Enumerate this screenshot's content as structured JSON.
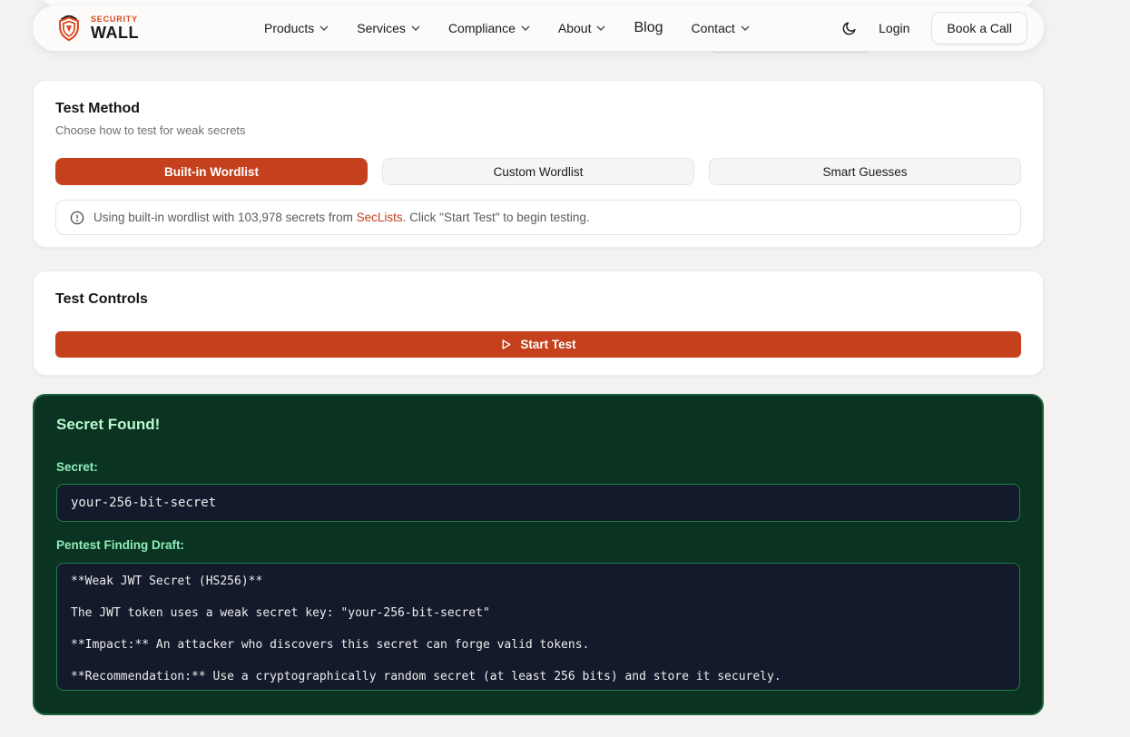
{
  "nav": {
    "brand": {
      "top": "SECURITY",
      "bottom": "WALL"
    },
    "items": [
      {
        "label": "Products"
      },
      {
        "label": "Services"
      },
      {
        "label": "Compliance"
      },
      {
        "label": "About"
      },
      {
        "label": "Blog"
      },
      {
        "label": "Contact"
      }
    ],
    "login_label": "Login",
    "book_call_label": "Book a Call"
  },
  "test_method": {
    "title": "Test Method",
    "subtitle": "Choose how to test for weak secrets",
    "options": [
      {
        "label": "Built-in Wordlist",
        "active": true
      },
      {
        "label": "Custom Wordlist",
        "active": false
      },
      {
        "label": "Smart Guesses",
        "active": false
      }
    ],
    "info_prefix": "Using built-in wordlist with 103,978 secrets from ",
    "info_link": "SecLists",
    "info_suffix": ". Click \"Start Test\" to begin testing."
  },
  "test_controls": {
    "title": "Test Controls",
    "start_button_label": "Start Test"
  },
  "result": {
    "title": "Secret Found!",
    "secret_label": "Secret:",
    "secret_value": "your-256-bit-secret",
    "finding_label": "Pentest Finding Draft:",
    "finding_draft": "**Weak JWT Secret (HS256)**\n\nThe JWT token uses a weak secret key: \"your-256-bit-secret\"\n\n**Impact:** An attacker who discovers this secret can forge valid tokens.\n\n**Recommendation:** Use a cryptographically random secret (at least 256 bits) and store it securely."
  },
  "colors": {
    "accent": "#C5411D",
    "result_background": "#0A3321",
    "result_border": "#1B6038",
    "mint_text": "#BBF7D0",
    "code_background": "#131A2B",
    "code_border": "#1E7E46"
  }
}
